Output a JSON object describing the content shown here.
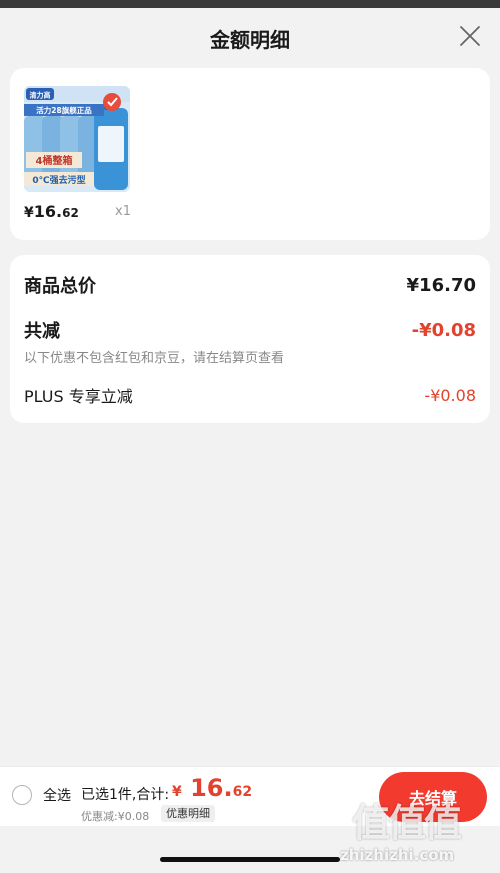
{
  "sheet": {
    "title": "金额明细",
    "close_icon": "close-icon"
  },
  "product": {
    "image": {
      "brand_text": "清力高",
      "banner_text": "活力28旗舰正品",
      "badge_text": "4桶整箱",
      "tagline_text": "0℃强去污型",
      "check_icon": "check-badge-icon"
    },
    "price_currency": "¥",
    "price_integer": "16.",
    "price_decimal": "62",
    "quantity": "x1"
  },
  "summary": {
    "total_label": "商品总价",
    "total_value": "¥16.70",
    "discount_label": "共减",
    "discount_value": "-¥0.08",
    "note": "以下优惠不包含红包和京豆，请在结算页查看",
    "plus_label": "PLUS 专享立减",
    "plus_value": "-¥0.08"
  },
  "bottom_bar": {
    "select_all_label": "全选",
    "selected_text": "已选1件,合计:",
    "total_currency": "¥",
    "total_integer": " 16.",
    "total_decimal": "62",
    "discount_text": "优惠减:¥0.08",
    "detail_tag": "优惠明细",
    "checkout_label": "去结算"
  },
  "watermark": {
    "logo": "值值值",
    "url": "zhizhizhi.com"
  },
  "colors": {
    "accent_red": "#e2432e",
    "button_red": "#f23a2f",
    "background": "#f2f2f2"
  }
}
